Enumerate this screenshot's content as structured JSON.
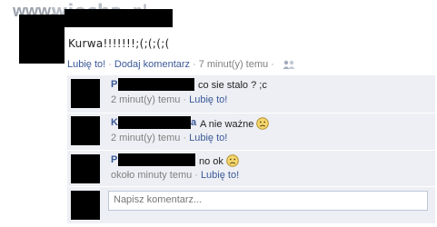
{
  "watermark": {
    "www": "www.",
    "name": "wiocha",
    "dot": ".",
    "tld": "pl"
  },
  "post": {
    "text": "Kurwa!!!!!!!;(;(;(;(",
    "like_label": "Lubię to!",
    "comment_label": "Dodaj komentarz",
    "time": "7 minut(y) temu",
    "separator": "·"
  },
  "comments": [
    {
      "name_initial": "P",
      "text": "co sie stalo ? ;c",
      "time": "2 minut(y) temu",
      "like_label": "Lubię to!"
    },
    {
      "name_initial": "K",
      "name_tail": "a",
      "text": "A nie ważne",
      "time": "2 minut(y) temu",
      "like_label": "Lubię to!"
    },
    {
      "name_initial": "P",
      "text": "no ok",
      "time": "około minuty temu",
      "like_label": "Lubię to!"
    }
  ],
  "comment_box": {
    "placeholder": "Napisz komentarz..."
  },
  "icons": {
    "people": "people-icon",
    "smiley": "sad-face-icon"
  },
  "colors": {
    "link": "#3b5998",
    "comment_bg": "#edeff4",
    "muted": "#808080",
    "smiley": "#f5d76e"
  }
}
